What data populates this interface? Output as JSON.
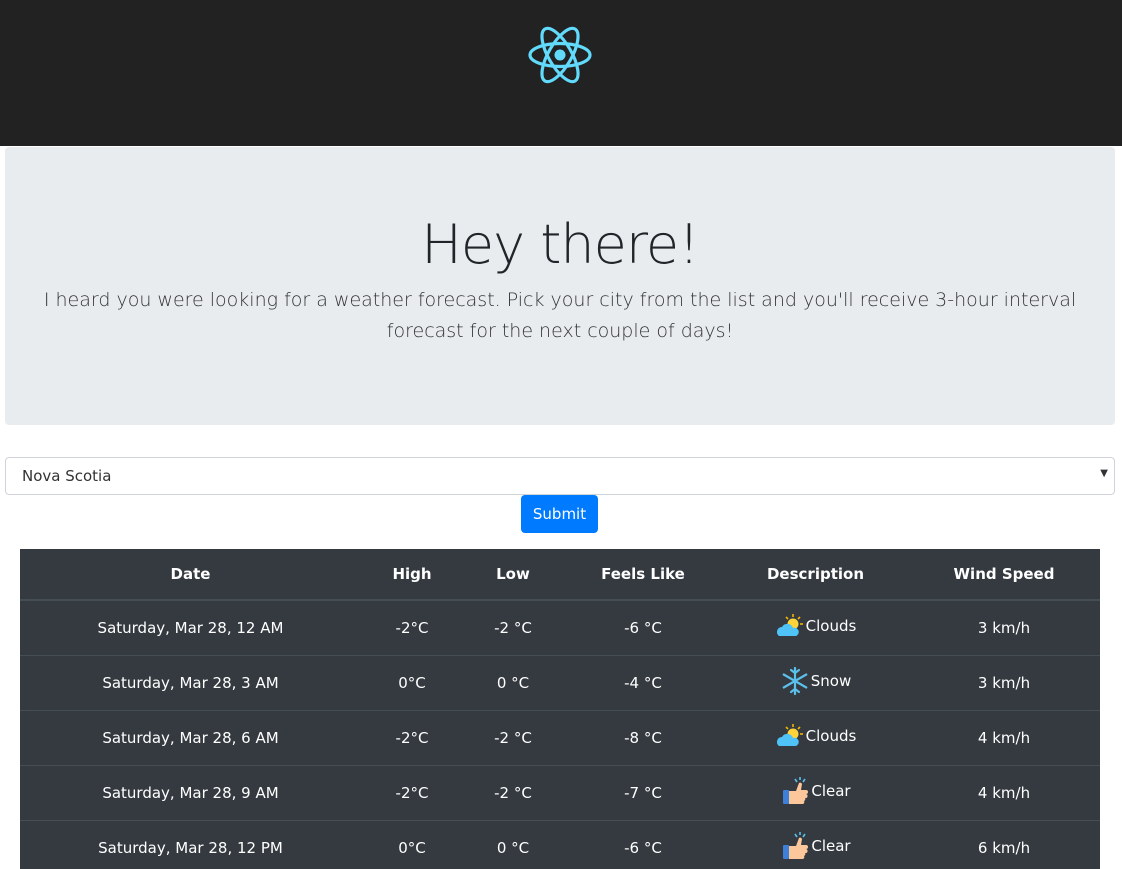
{
  "header": {
    "logo_icon": "react-atom-icon",
    "logo_color": "#61dafb"
  },
  "hero": {
    "title": "Hey there!",
    "subtitle": "I heard you were looking for a weather forecast. Pick your city from the list and you'll receive 3-hour interval forecast for the next couple of days!"
  },
  "form": {
    "city_select_value": "Nova Scotia",
    "submit_label": "Submit",
    "accent_color": "#007bff"
  },
  "forecast": {
    "columns": [
      "Date",
      "High",
      "Low",
      "Feels Like",
      "Description",
      "Wind Speed"
    ],
    "rows": [
      {
        "date": "Saturday, Mar 28, 12 AM",
        "high": "-2°C",
        "low": "-2 °C",
        "feels": "-6 °C",
        "icon": "clouds-icon",
        "desc": "Clouds",
        "wind": "3 km/h"
      },
      {
        "date": "Saturday, Mar 28, 3 AM",
        "high": "0°C",
        "low": "0 °C",
        "feels": "-4 °C",
        "icon": "snow-icon",
        "desc": "Snow",
        "wind": "3 km/h"
      },
      {
        "date": "Saturday, Mar 28, 6 AM",
        "high": "-2°C",
        "low": "-2 °C",
        "feels": "-8 °C",
        "icon": "clouds-icon",
        "desc": "Clouds",
        "wind": "4 km/h"
      },
      {
        "date": "Saturday, Mar 28, 9 AM",
        "high": "-2°C",
        "low": "-2 °C",
        "feels": "-7 °C",
        "icon": "clear-icon",
        "desc": "Clear",
        "wind": "4 km/h"
      },
      {
        "date": "Saturday, Mar 28, 12 PM",
        "high": "0°C",
        "low": "0 °C",
        "feels": "-6 °C",
        "icon": "clear-icon",
        "desc": "Clear",
        "wind": "6 km/h"
      }
    ]
  }
}
